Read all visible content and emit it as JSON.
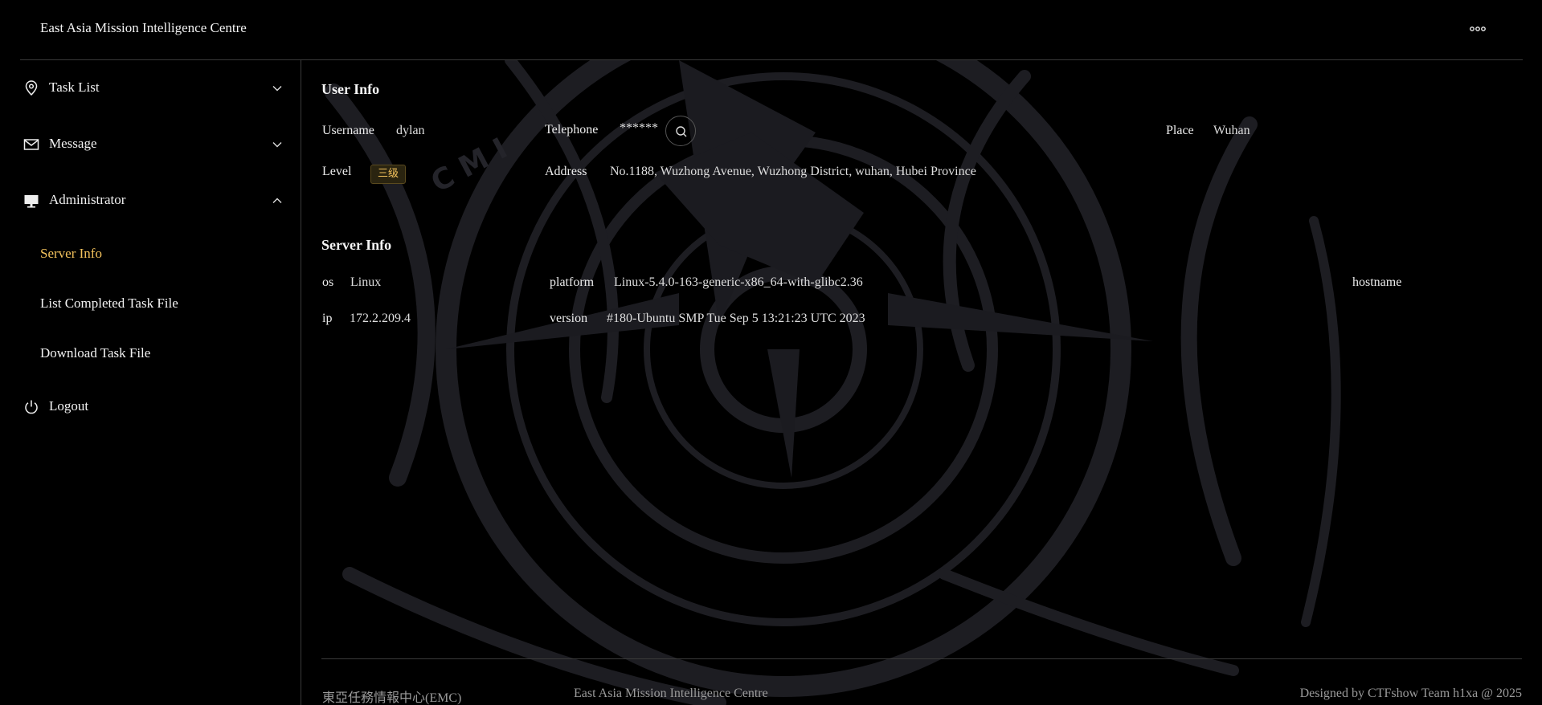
{
  "header": {
    "title": "East Asia Mission Intelligence Centre",
    "more_icon": "ellipsis-icon"
  },
  "sidebar": {
    "menus": [
      {
        "label": "Task List",
        "icon": "location-pin-icon",
        "expanded": false
      },
      {
        "label": "Message",
        "icon": "mail-icon",
        "expanded": false
      },
      {
        "label": "Administrator",
        "icon": "monitor-icon",
        "expanded": true
      }
    ],
    "admin_items": [
      {
        "label": "Server Info",
        "active": true
      },
      {
        "label": "List Completed Task File",
        "active": false
      },
      {
        "label": "Download Task File",
        "active": false
      }
    ],
    "logout": {
      "label": "Logout",
      "icon": "power-icon"
    }
  },
  "user_info": {
    "title": "User Info",
    "username_label": "Username",
    "username": "dylan",
    "telephone_label": "Telephone",
    "telephone": "******",
    "place_label": "Place",
    "place": "Wuhan",
    "level_label": "Level",
    "level": "三级",
    "address_label": "Address",
    "address": "No.1188, Wuzhong Avenue, Wuzhong District, wuhan, Hubei Province"
  },
  "server_info": {
    "title": "Server Info",
    "os_label": "os",
    "os": "Linux",
    "platform_label": "platform",
    "platform": "Linux-5.4.0-163-generic-x86_64-with-glibc2.36",
    "hostname_label": "hostname",
    "ip_label": "ip",
    "ip": "172.2.209.4",
    "version_label": "version",
    "version": "#180-Ubuntu SMP Tue Sep 5 13:21:23 UTC 2023"
  },
  "footer": {
    "left": "東亞任務情報中心(EMC)",
    "center": "East Asia Mission Intelligence Centre",
    "right": "Designed by CTFshow Team h1xa @ 2025"
  },
  "colors": {
    "background": "#000000",
    "accent": "#f3c25c",
    "text": "#f2f2f2",
    "divider": "#3a3a3a"
  }
}
